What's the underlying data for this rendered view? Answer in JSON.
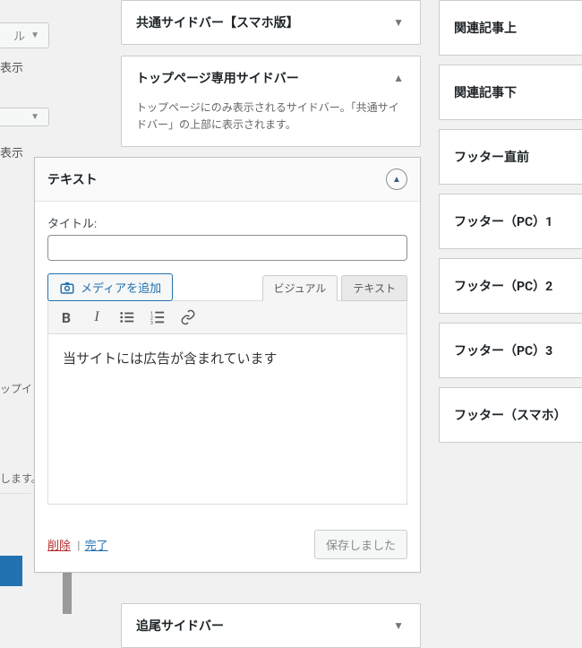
{
  "left_fragments": {
    "btn1_label": "ル",
    "text1": "表示",
    "text2": "表示",
    "drop_text": "ップイ",
    "apply_text": "します。"
  },
  "widget_areas": {
    "area1": {
      "title": "共通サイドバー【スマホ版】"
    },
    "area2": {
      "title": "トップページ専用サイドバー",
      "desc": "トップページにのみ表示されるサイドバー。「共通サイドバー」の上部に表示されます。"
    },
    "area_bottom": {
      "title": "追尾サイドバー"
    }
  },
  "right_areas": [
    "関連記事上",
    "関連記事下",
    "フッター直前",
    "フッター（PC）1",
    "フッター（PC）2",
    "フッター（PC）3",
    "フッター（スマホ）"
  ],
  "editor": {
    "widget_name": "テキスト",
    "title_label": "タイトル:",
    "title_value": "",
    "media_button": "メディアを追加",
    "tab_visual": "ビジュアル",
    "tab_text": "テキスト",
    "content": "当サイトには広告が含まれています",
    "delete": "削除",
    "done": "完了",
    "saved": "保存しました"
  }
}
